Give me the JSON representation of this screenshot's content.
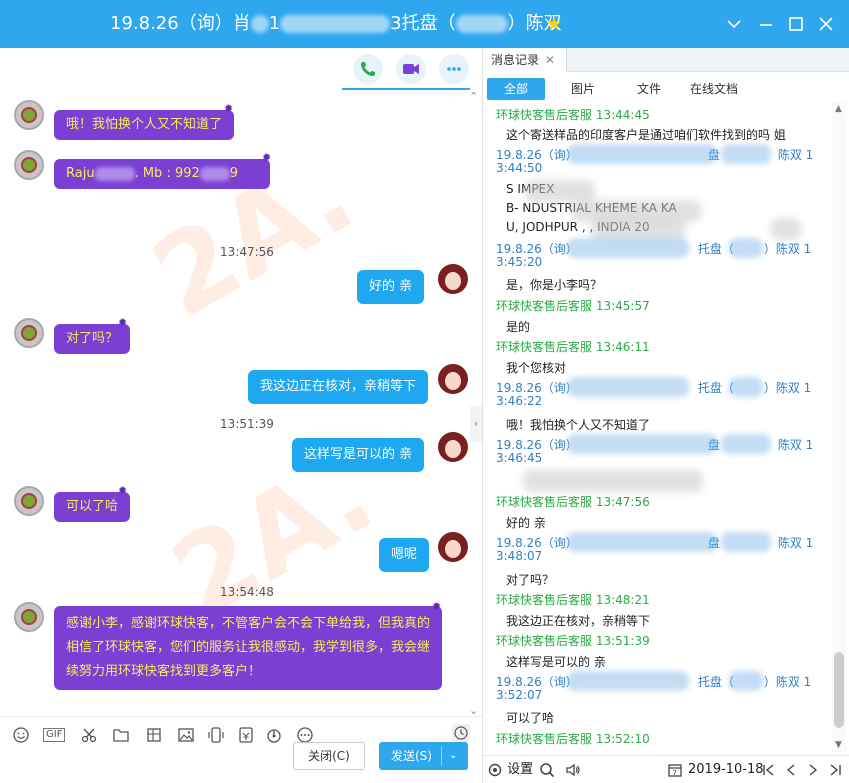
{
  "window": {
    "title_prefix": "19.8.26（询）肖",
    "title_mid": "1",
    "title_suffix": "3托盘（",
    "title_end": "）陈双",
    "star_icon": "star-icon",
    "accent": "#2ea7ee"
  },
  "chat": {
    "messages": [
      {
        "side": "left",
        "text": "哦！我怕换个人又不知道了"
      },
      {
        "side": "left",
        "text_a": "Raju",
        "text_b": ".  Mb : 992",
        "text_c": "9"
      },
      {
        "side": "time",
        "text": "13:47:56"
      },
      {
        "side": "right",
        "text": "好的  亲"
      },
      {
        "side": "left",
        "text": "对了吗？"
      },
      {
        "side": "right",
        "text": "我这边正在核对，亲稍等下"
      },
      {
        "side": "time",
        "text": "13:51:39"
      },
      {
        "side": "right",
        "text": "这样写是可以的  亲"
      },
      {
        "side": "left",
        "text": "可以了哈"
      },
      {
        "side": "right",
        "text": "嗯呢"
      },
      {
        "side": "time",
        "text": "13:54:48"
      },
      {
        "side": "left",
        "text": "感谢小李，感谢环球快客，不管客户会不会下单给我，但我真的相信了环球快客，您们的服务让我很感动，我学到很多，我会继续努力用环球快客找到更多客户！"
      }
    ],
    "gif_label": "GIF",
    "close_button": "关闭(C)",
    "send_button": "发送(S)",
    "left_bubble_color": "#7b3fd4",
    "right_bubble_color": "#1fa8ef"
  },
  "history": {
    "tab_label": "消息记录",
    "filters": [
      "全部",
      "图片",
      "文件",
      "在线文档"
    ],
    "entries": [
      {
        "kind": "agent",
        "head": "环球快客售后客服 13:44:45",
        "body": "这个寄送样品的印度客户是通过咱们软件找到的吗     姐"
      },
      {
        "kind": "cust",
        "head_a": "19.8.26（询）",
        "head_b": "盘",
        "head_c": "陈双  1",
        "head_d": "3:44:50"
      },
      {
        "kind": "addr",
        "l1": "S      IMPEX",
        "l2": "B-        NDUSTRIAL                  KHEME KA KA",
        "l3": "U, JODHPUR ,                          , INDIA        20"
      },
      {
        "kind": "cust",
        "head_a": "19.8.26（询）",
        "head_b": "托盘（",
        "head_c": "）陈双  1",
        "head_d": "3:45:20"
      },
      {
        "kind": "bodyonly",
        "body": "是，你是小李吗？"
      },
      {
        "kind": "agent",
        "head": "环球快客售后客服 13:45:57",
        "body": "是的"
      },
      {
        "kind": "agent",
        "head": "环球快客售后客服 13:46:11",
        "body": "我个您核对"
      },
      {
        "kind": "cust",
        "head_a": "19.8.26（询）",
        "head_b": "托盘（",
        "head_c": "）陈双  1",
        "head_d": "3:46:22"
      },
      {
        "kind": "bodyonly",
        "body": "哦！我怕换个人又不知道了"
      },
      {
        "kind": "cust",
        "head_a": "19.8.26（询）",
        "head_b": "盘",
        "head_c": "陈双  1",
        "head_d": "3:46:45"
      },
      {
        "kind": "agent",
        "head": "环球快客售后客服 13:47:56",
        "body": "好的  亲"
      },
      {
        "kind": "cust",
        "head_a": "19.8.26（询）",
        "head_b": "盘",
        "head_c": "陈双  1",
        "head_d": "3:48:07"
      },
      {
        "kind": "bodyonly",
        "body": "对了吗？"
      },
      {
        "kind": "agent",
        "head": "环球快客售后客服 13:48:21",
        "body": "我这边正在核对，亲稍等下"
      },
      {
        "kind": "agent",
        "head": "环球快客售后客服 13:51:39",
        "body": "这样写是可以的  亲"
      },
      {
        "kind": "cust",
        "head_a": "19.8.26（询）",
        "head_b": "托盘（",
        "head_c": "）陈双  1",
        "head_d": "3:52:07"
      },
      {
        "kind": "bodyonly",
        "body": "可以了哈"
      },
      {
        "kind": "agent",
        "head": "环球快客售后客服 13:52:10",
        "body": ""
      }
    ],
    "settings_label": "设置",
    "date": "2019-10-18",
    "agent_color": "#2bab46",
    "customer_color": "#2e7fc7"
  }
}
